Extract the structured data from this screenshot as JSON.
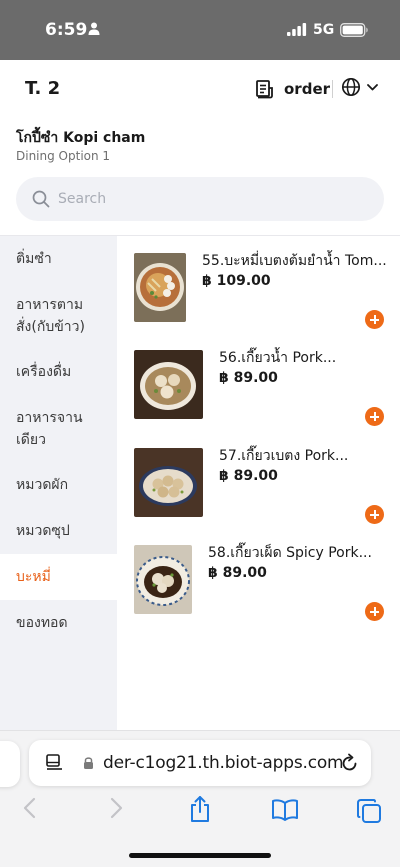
{
  "status_bar": {
    "time": "6:59",
    "network": "5G",
    "icons": [
      "person-icon",
      "signal-icon",
      "battery-icon"
    ]
  },
  "header": {
    "table_label": "T. 2",
    "order_label": "order",
    "icons": [
      "receipt-icon",
      "globe-icon",
      "chevron-down-icon"
    ]
  },
  "store": {
    "name": "โกปี้ซำ Kopi cham",
    "dining_option": "Dining Option 1"
  },
  "search": {
    "placeholder": "Search",
    "value": ""
  },
  "categories": [
    {
      "label": "ติ่มซำ",
      "active": false
    },
    {
      "label": "อาหารตามสั่ง(กับข้าว)",
      "active": false
    },
    {
      "label": "เครื่องดื่ม",
      "active": false
    },
    {
      "label": "อาหารจานเดียว",
      "active": false
    },
    {
      "label": "หมวดผัก",
      "active": false
    },
    {
      "label": "หมวดซุป",
      "active": false
    },
    {
      "label": "บะหมี่",
      "active": true
    },
    {
      "label": "ของทอด",
      "active": false
    }
  ],
  "menu_items": [
    {
      "name": "55.บะหมี่เบตงต้มยำน้ำ Tom...",
      "price": "฿ 109.00",
      "image": "noodle-tomyum-photo"
    },
    {
      "name": "56.เกี๊ยวน้ำ Pork...",
      "price": "฿ 89.00",
      "image": "wonton-soup-photo"
    },
    {
      "name": "57.เกี๊ยวเบตง Pork...",
      "price": "฿ 89.00",
      "image": "betong-dumpling-photo"
    },
    {
      "name": "58.เกี๊ยวเผ็ด Spicy Pork...",
      "price": "฿ 89.00",
      "image": "spicy-wonton-photo"
    }
  ],
  "colors": {
    "accent": "#ee6a17",
    "sidebar_bg": "#f1f2f6",
    "status_bar_bg": "#6b6b6b"
  },
  "browser": {
    "url": "der-c1og21.th.biot-apps.com",
    "icons": [
      "page-menu-icon",
      "lock-icon",
      "reload-icon",
      "back-icon",
      "forward-icon",
      "share-icon",
      "bookmarks-icon",
      "tabs-icon"
    ]
  }
}
